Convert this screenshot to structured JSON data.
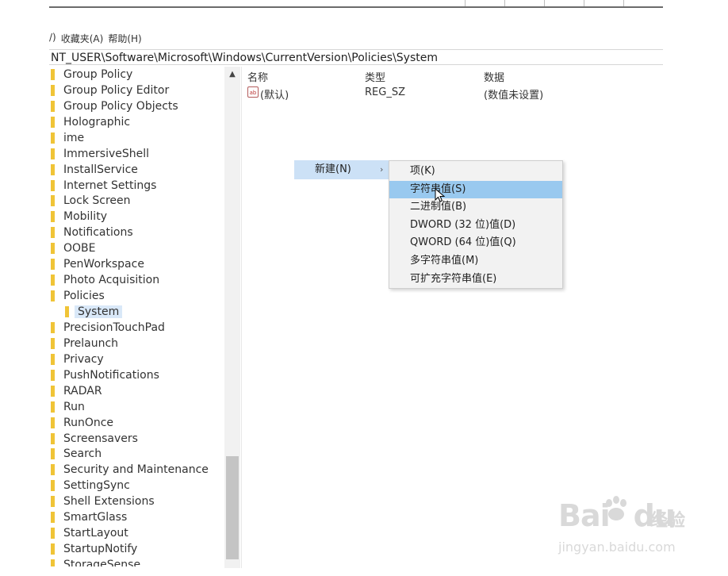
{
  "menubar": {
    "partial": "/)",
    "favorites": "收藏夹(A)",
    "help": "帮助(H)"
  },
  "address_bar": {
    "path": "NT_USER\\Software\\Microsoft\\Windows\\CurrentVersion\\Policies\\System"
  },
  "tree": {
    "items": [
      {
        "label": "Group Policy",
        "child": false,
        "selected": false
      },
      {
        "label": "Group Policy Editor",
        "child": false,
        "selected": false
      },
      {
        "label": "Group Policy Objects",
        "child": false,
        "selected": false
      },
      {
        "label": "Holographic",
        "child": false,
        "selected": false
      },
      {
        "label": "ime",
        "child": false,
        "selected": false
      },
      {
        "label": "ImmersiveShell",
        "child": false,
        "selected": false
      },
      {
        "label": "InstallService",
        "child": false,
        "selected": false
      },
      {
        "label": "Internet Settings",
        "child": false,
        "selected": false
      },
      {
        "label": "Lock Screen",
        "child": false,
        "selected": false
      },
      {
        "label": "Mobility",
        "child": false,
        "selected": false
      },
      {
        "label": "Notifications",
        "child": false,
        "selected": false
      },
      {
        "label": "OOBE",
        "child": false,
        "selected": false
      },
      {
        "label": "PenWorkspace",
        "child": false,
        "selected": false
      },
      {
        "label": "Photo Acquisition",
        "child": false,
        "selected": false
      },
      {
        "label": "Policies",
        "child": false,
        "selected": false
      },
      {
        "label": "System",
        "child": true,
        "selected": true
      },
      {
        "label": "PrecisionTouchPad",
        "child": false,
        "selected": false
      },
      {
        "label": "Prelaunch",
        "child": false,
        "selected": false
      },
      {
        "label": "Privacy",
        "child": false,
        "selected": false
      },
      {
        "label": "PushNotifications",
        "child": false,
        "selected": false
      },
      {
        "label": "RADAR",
        "child": false,
        "selected": false
      },
      {
        "label": "Run",
        "child": false,
        "selected": false
      },
      {
        "label": "RunOnce",
        "child": false,
        "selected": false
      },
      {
        "label": "Screensavers",
        "child": false,
        "selected": false
      },
      {
        "label": "Search",
        "child": false,
        "selected": false
      },
      {
        "label": "Security and Maintenance",
        "child": false,
        "selected": false
      },
      {
        "label": "SettingSync",
        "child": false,
        "selected": false
      },
      {
        "label": "Shell Extensions",
        "child": false,
        "selected": false
      },
      {
        "label": "SmartGlass",
        "child": false,
        "selected": false
      },
      {
        "label": "StartLayout",
        "child": false,
        "selected": false
      },
      {
        "label": "StartupNotify",
        "child": false,
        "selected": false
      },
      {
        "label": "StorageSense",
        "child": false,
        "selected": false
      }
    ]
  },
  "list": {
    "headers": {
      "name": "名称",
      "type": "类型",
      "data": "数据"
    },
    "rows": [
      {
        "icon": "string-value-icon",
        "icon_text": "ab",
        "name": "(默认)",
        "type": "REG_SZ",
        "data": "(数值未设置)"
      }
    ]
  },
  "context_menu": {
    "new_label": "新建(N)",
    "new_arrow": "›",
    "submenu": [
      {
        "label": "项(K)",
        "highlighted": false
      },
      {
        "label": "字符串值(S)",
        "highlighted": true
      },
      {
        "label": "二进制值(B)",
        "highlighted": false
      },
      {
        "label": "DWORD (32 位)值(D)",
        "highlighted": false
      },
      {
        "label": "QWORD (64 位)值(Q)",
        "highlighted": false
      },
      {
        "label": "多字符串值(M)",
        "highlighted": false
      },
      {
        "label": "可扩充字符串值(E)",
        "highlighted": false
      }
    ]
  },
  "watermark": {
    "brand": "Bai",
    "brand2": "du",
    "cn": "经验",
    "url": "jingyan.baidu.com"
  },
  "colors": {
    "folder": "#f0c437",
    "selection": "#d9e8f8",
    "menu_highlight": "#99c9ef",
    "menu_parent": "#cce1f6"
  }
}
